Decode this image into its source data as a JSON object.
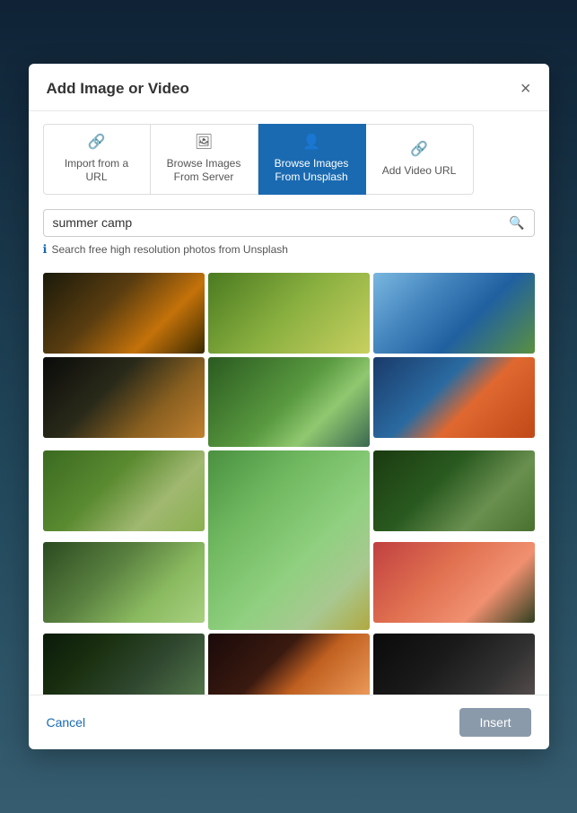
{
  "modal": {
    "title": "Add Image or Video",
    "close_label": "×"
  },
  "tabs": [
    {
      "id": "import-url",
      "label": "Import from a\nURL",
      "icon": "🔗",
      "active": false
    },
    {
      "id": "browse-server",
      "label": "Browse Images\nFrom Server",
      "icon": "🖼",
      "active": false
    },
    {
      "id": "browse-unsplash",
      "label": "Browse Images\nFrom Unsplash",
      "icon": "👤",
      "active": true
    },
    {
      "id": "add-video",
      "label": "Add Video URL",
      "icon": "🔗",
      "active": false
    }
  ],
  "search": {
    "value": "summer camp",
    "placeholder": "summer camp",
    "hint": "Search free high resolution photos from Unsplash"
  },
  "images": [
    {
      "id": 1,
      "class": "img-1"
    },
    {
      "id": 2,
      "class": "img-2"
    },
    {
      "id": 3,
      "class": "img-3"
    },
    {
      "id": 4,
      "class": "img-4"
    },
    {
      "id": 5,
      "class": "img-5"
    },
    {
      "id": 6,
      "class": "img-6"
    },
    {
      "id": 7,
      "class": "img-7"
    },
    {
      "id": 8,
      "class": "img-8"
    },
    {
      "id": 9,
      "class": "img-9"
    },
    {
      "id": 10,
      "class": "img-10"
    },
    {
      "id": 11,
      "class": "img-11"
    },
    {
      "id": 12,
      "class": "img-12"
    },
    {
      "id": 13,
      "class": "img-13"
    },
    {
      "id": 14,
      "class": "img-14"
    },
    {
      "id": 15,
      "class": "img-15"
    }
  ],
  "footer": {
    "cancel_label": "Cancel",
    "insert_label": "Insert"
  }
}
